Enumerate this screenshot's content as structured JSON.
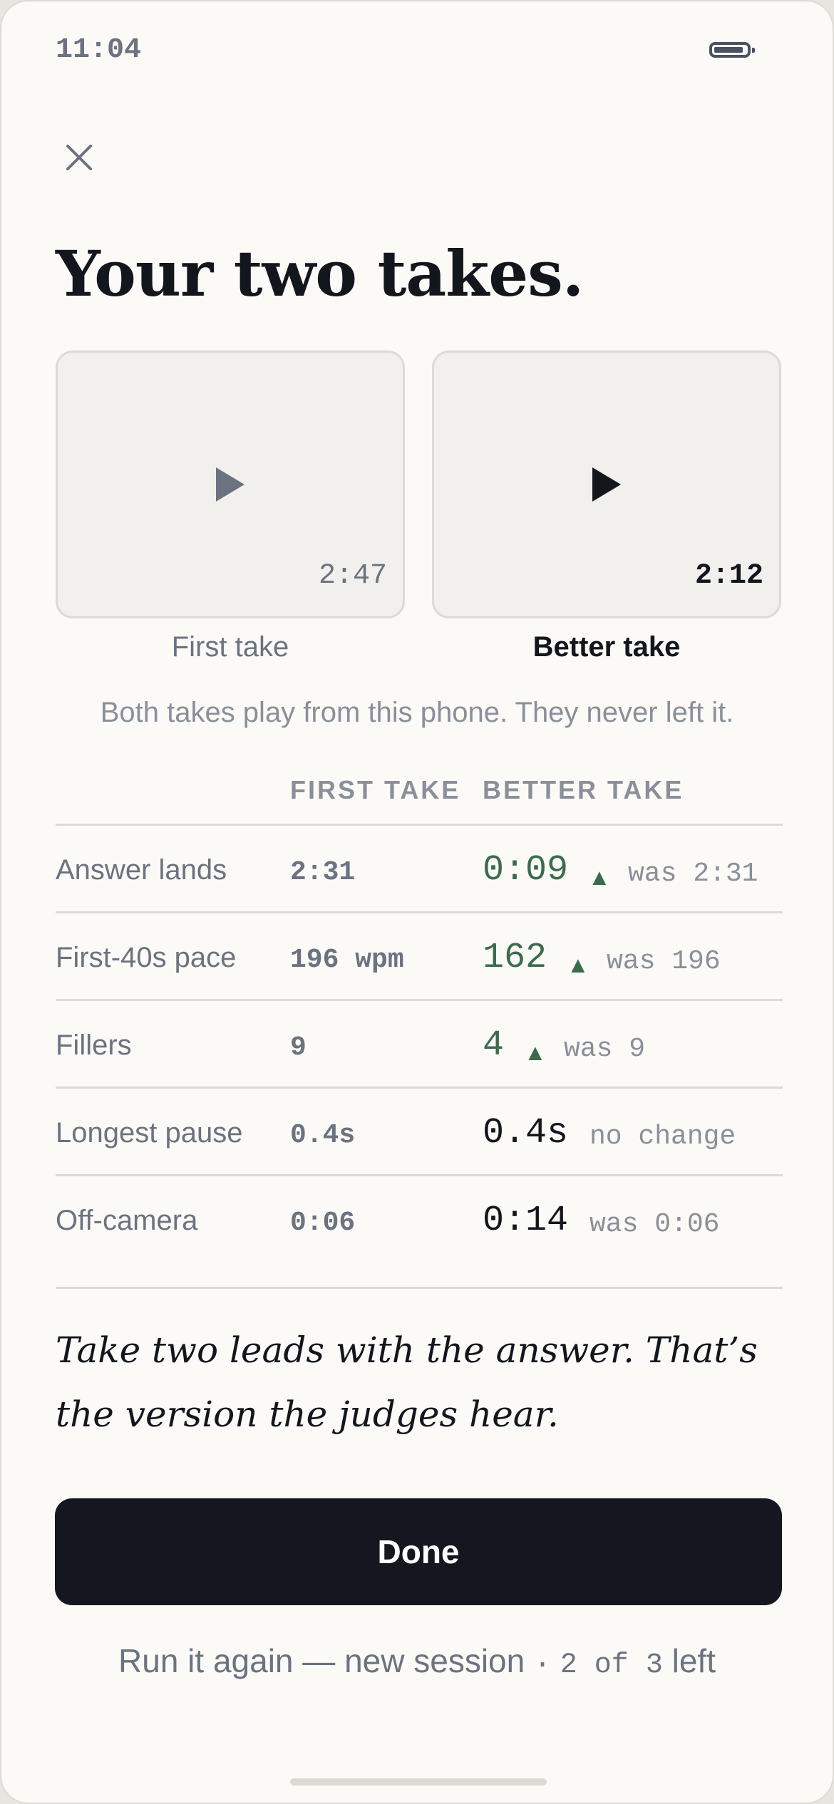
{
  "status_bar": {
    "time": "11:04",
    "battery_icon": "battery-icon"
  },
  "close_icon": "close-icon",
  "title": "Your two takes.",
  "takes": [
    {
      "label": "First take",
      "duration": "2:47",
      "icon": "play-icon",
      "play_color": "#6b7280"
    },
    {
      "label": "Better take",
      "duration": "2:12",
      "icon": "play-icon",
      "play_color": "#14161d"
    }
  ],
  "note": "Both takes play from this phone. They never left it.",
  "table": {
    "columns": [
      "FIRST TAKE",
      "BETTER TAKE"
    ],
    "rows": [
      {
        "metric": "Answer lands",
        "first": "2:31",
        "better": "0:09",
        "improved": true,
        "delta": "was 2:31"
      },
      {
        "metric": "First-40s pace",
        "first": "196 wpm",
        "better": "162",
        "improved": true,
        "delta": "was 196"
      },
      {
        "metric": "Fillers",
        "first": "9",
        "better": "4",
        "improved": true,
        "delta": "was 9"
      },
      {
        "metric": "Longest pause",
        "first": "0.4s",
        "better": "0.4s",
        "improved": false,
        "delta": "no change"
      },
      {
        "metric": "Off-camera",
        "first": "0:06",
        "better": "0:14",
        "improved": false,
        "delta": "was 0:06"
      }
    ],
    "arrow_glyph": "▲"
  },
  "quote": "Take two leads with the answer. That’s the version the judges hear.",
  "done_label": "Done",
  "again": {
    "text": "Run it again — new session",
    "separator": "·",
    "count": "2 of 3",
    "suffix": "left"
  },
  "colors": {
    "accent_green": "#3c6b4c",
    "button_bg": "#14171f",
    "background": "#fbfaf7"
  }
}
